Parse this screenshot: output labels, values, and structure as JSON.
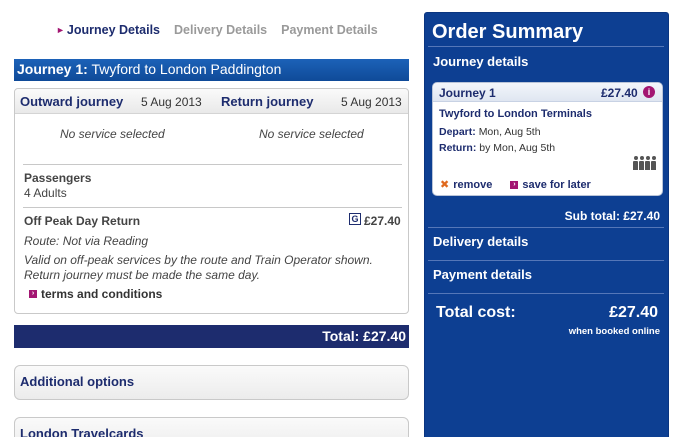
{
  "steps": [
    {
      "label": "Journey Details",
      "active": true
    },
    {
      "label": "Delivery Details",
      "active": false
    },
    {
      "label": "Payment Details",
      "active": false
    }
  ],
  "journey": {
    "title_prefix": "Journey 1:",
    "title_route": "Twyford to London Paddington",
    "outward_label": "Outward journey",
    "outward_date": "5 Aug 2013",
    "return_label": "Return journey",
    "return_date": "5 Aug 2013",
    "outward_service": "No service selected",
    "return_service": "No service selected",
    "passengers_label": "Passengers",
    "passengers_value": "4 Adults",
    "fare_name": "Off Peak Day Return",
    "fare_icon": "G",
    "fare_price": "£27.40",
    "route_text": "Route: Not via Reading",
    "validity_text": "Valid on off-peak services by the route and Train Operator shown. Return journey must be made the same day.",
    "terms_label": "terms and conditions"
  },
  "total_label": "Total: £27.40",
  "options": [
    {
      "label": "Additional options"
    },
    {
      "label": "London Travelcards"
    }
  ],
  "summary": {
    "title": "Order Summary",
    "journey_details_label": "Journey details",
    "card": {
      "journey": "Journey 1",
      "price": "£27.40",
      "info_icon": "i",
      "stations": "Twyford to London Terminals",
      "depart_label": "Depart:",
      "depart_value": "Mon, Aug 5th",
      "return_label": "Return:",
      "return_value": "by Mon, Aug 5th",
      "remove_label": "remove",
      "save_label": "save for later"
    },
    "subtotal": "Sub total: £27.40",
    "delivery_label": "Delivery details",
    "payment_label": "Payment details",
    "total_cost_label": "Total cost:",
    "total_cost_value": "£27.40",
    "online_note": "when booked online"
  },
  "colors": {
    "navy": "#1d2c6e",
    "summary_blue": "#0d3f92",
    "magenta": "#a31672",
    "orange": "#e06a1f"
  }
}
